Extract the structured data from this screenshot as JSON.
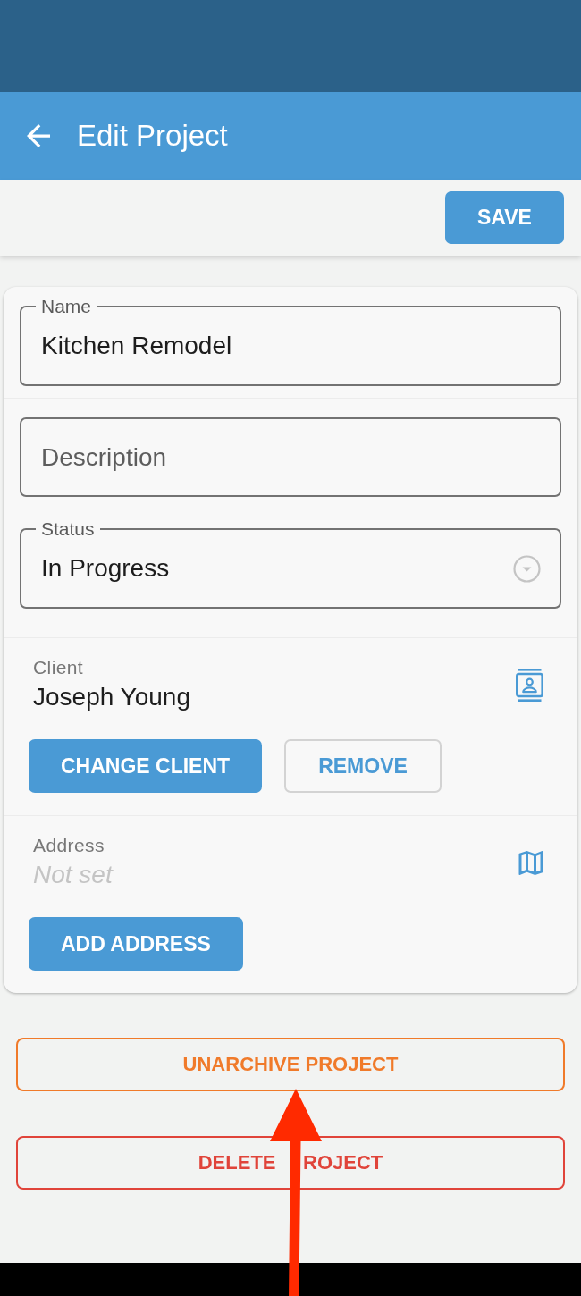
{
  "app_bar": {
    "title": "Edit Project"
  },
  "toolbar": {
    "save": "SAVE"
  },
  "form": {
    "fields": [
      {
        "kind": "text",
        "label": "Name",
        "value": "Kitchen Remodel"
      },
      {
        "kind": "text",
        "placeholder": "Description"
      },
      {
        "kind": "select",
        "label": "Status",
        "value": "In Progress"
      }
    ],
    "sections": [
      {
        "kind": "client",
        "label": "Client",
        "value": "Joseph Young",
        "empty": false,
        "actions": [
          {
            "kind": "filled",
            "label": "CHANGE CLIENT"
          },
          {
            "kind": "outlined",
            "label": "REMOVE"
          }
        ]
      },
      {
        "kind": "address",
        "label": "Address",
        "value": "Not set",
        "empty": true,
        "actions": [
          {
            "kind": "filled",
            "label": "ADD ADDRESS"
          }
        ]
      }
    ]
  },
  "footer_actions": [
    {
      "label": "UNARCHIVE PROJECT",
      "color": "#f07a2a"
    },
    {
      "label": "DELETE     ROJECT",
      "color": "#e0443a"
    }
  ],
  "annotations": [
    {
      "kind": "arrow"
    }
  ]
}
